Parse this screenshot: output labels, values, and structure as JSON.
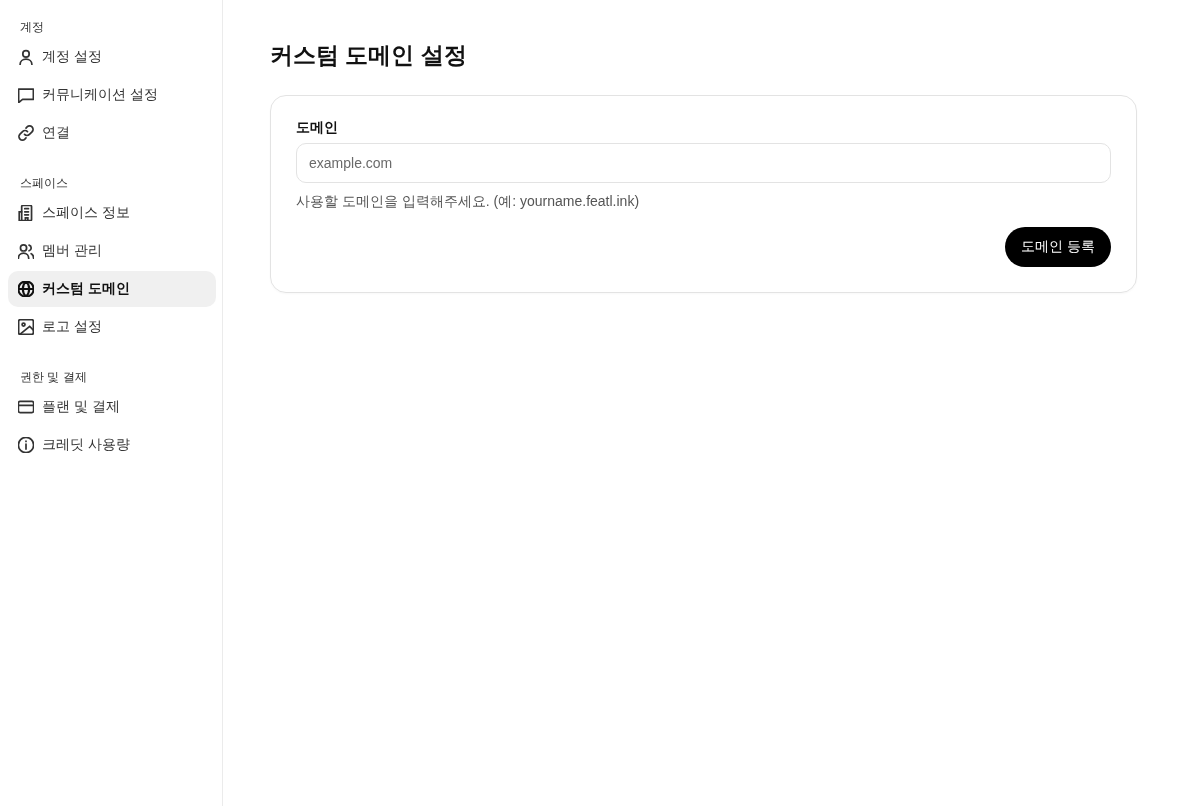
{
  "sidebar": {
    "sections": [
      {
        "heading": "계정",
        "items": [
          {
            "label": "계정 설정",
            "selected": false
          },
          {
            "label": "커뮤니케이션 설정",
            "selected": false
          },
          {
            "label": "연결",
            "selected": false
          }
        ]
      },
      {
        "heading": "스페이스",
        "items": [
          {
            "label": "스페이스 정보",
            "selected": false
          },
          {
            "label": "멤버 관리",
            "selected": false
          },
          {
            "label": "커스텀 도메인",
            "selected": true
          },
          {
            "label": "로고 설정",
            "selected": false
          }
        ]
      },
      {
        "heading": "권한 및 결제",
        "items": [
          {
            "label": "플랜 및 결제",
            "selected": false
          },
          {
            "label": "크레딧 사용량",
            "selected": false
          }
        ]
      }
    ]
  },
  "main": {
    "title": "커스텀 도메인 설정",
    "card": {
      "field_label": "도메인",
      "input": {
        "placeholder": "example.com"
      },
      "hint": "사용할 도메인을 입력해주세요. (예: yourname.featl.ink)",
      "button": "도메인 등록"
    }
  }
}
